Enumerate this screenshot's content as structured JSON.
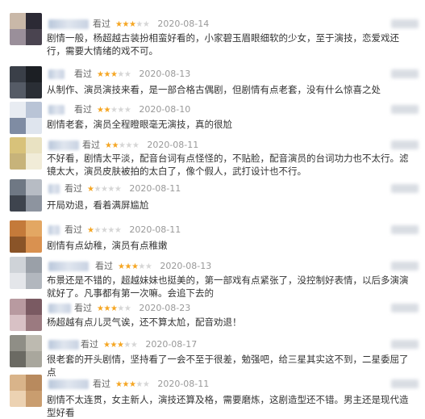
{
  "rating_label": "看过",
  "colors": {
    "star_on": "#f5a623",
    "star_off": "#d6d6d6"
  },
  "reviews": [
    {
      "stars": 3,
      "date": "2020-08-14",
      "text": "剧情一般，杨超越古装扮相蛮好看的，小家碧玉眉眼细软的少女，至于演技，恋爱戏还行，需要大情绪的戏不可。",
      "avatar_colors": [
        "#c9b8a8",
        "#2c2a35",
        "#9a8f9a",
        "#4a4450"
      ]
    },
    {
      "stars": 3,
      "date": "2020-08-13",
      "text": "从制作、演员演技来看，是一部合格古偶剧，但剧情有点老套，没有什么惊喜之处",
      "avatar_colors": [
        "#3a3f48",
        "#1c1f24",
        "#555b66",
        "#2a2e35"
      ]
    },
    {
      "stars": 2,
      "date": "2020-08-10",
      "text": "剧情老套，演员全程瞪眼毫无演技，真的很尬",
      "avatar_colors": [
        "#e8ecf2",
        "#b9c4d6",
        "#7f8ca3",
        "#dfe5ee"
      ]
    },
    {
      "stars": 2,
      "date": "2020-08-11",
      "text": "不好看，剧情太平淡，配音台词有点怪怪的，不贴脸，配音演员的台词功力也不太行。滤镜太大，演员皮肤被拍的太白了，像个假人，武打设计也不行。",
      "avatar_colors": [
        "#d8c27a",
        "#e9e2c2",
        "#c7b37a",
        "#f1ecd8"
      ]
    },
    {
      "stars": 1,
      "date": "2020-08-11",
      "text": "开局劝退，看着满屏尴尬",
      "avatar_colors": [
        "#6f7884",
        "#b7bcc4",
        "#3e444e",
        "#8d949f"
      ]
    },
    {
      "stars": 1,
      "date": "2020-08-11",
      "text": "剧情有点幼稚，演员有点稚嫩",
      "avatar_colors": [
        "#c47a3a",
        "#e3a763",
        "#8a5428",
        "#d99150"
      ]
    },
    {
      "stars": 3,
      "date": "2020-08-13",
      "text": "布景还是不错的，超越妹妹也挺美的，第一部戏有点紧张了，没控制好表情，以后多演演就好了。凡事都有第一次嘛。会追下去的",
      "avatar_colors": [
        "#cfd3d8",
        "#9aa0a8",
        "#e4e6ea",
        "#b2b7be"
      ]
    },
    {
      "stars": 3,
      "date": "2020-08-23",
      "text": "杨超越有点儿灵气诶，还不算太尬，配音劝退！",
      "avatar_colors": [
        "#b89aa0",
        "#7a5a62",
        "#d8c1c5",
        "#9b7a80"
      ]
    },
    {
      "stars": 3,
      "date": "2020-08-17",
      "text": "很老套的开头剧情，坚持看了一会不至于很差，勉强吧，给三星其实这不到，二星委屈了点",
      "avatar_colors": [
        "#8f8e86",
        "#bdbab0",
        "#6b6a63",
        "#a9a79d"
      ]
    },
    {
      "stars": 3,
      "date": "2020-08-11",
      "text": "剧情不太连贯，女主新人，演技还算及格，需要磨炼，这剧造型还不错。男主还是现代造型好看",
      "avatar_colors": [
        "#d9b48a",
        "#b88a5e",
        "#ecd2b2",
        "#c99d6f"
      ]
    }
  ]
}
